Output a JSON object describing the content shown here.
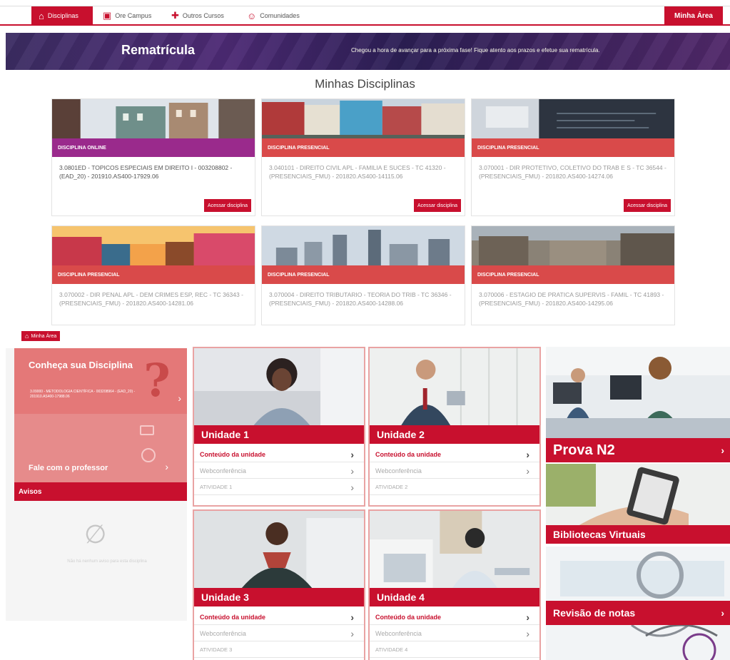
{
  "nav": {
    "disciplinas": "Disciplinas",
    "online_campus": "Ore Campus",
    "outros_cursos": "Outros Cursos",
    "comunidades": "Comunidades",
    "minha_area": "Minha Área"
  },
  "banner": {
    "title": "Rematrícula",
    "message": "Chegou a hora de avançar para a próxima fase! Fique atento aos prazos e efetue sua rematrícula."
  },
  "section_title": "Minhas Disciplinas",
  "courses": [
    {
      "type": "DISCIPLINA ONLINE",
      "name": "3.0801ED - TOPICOS ESPECIAIS EM DIREITO I - 003208802 - (EAD_20) - 201910.AS400-17929.06",
      "button": "Acessar disciplina"
    },
    {
      "type": "DISCIPLINA PRESENCIAL",
      "name": "3.040101 - DIREITO CIVIL APL - FAMILIA E SUCES - TC 41320 - (PRESENCIAIS_FMU) - 201820.AS400-14115.06",
      "button": "Acessar disciplina"
    },
    {
      "type": "DISCIPLINA PRESENCIAL",
      "name": "3.070001 - DIR PROTETIVO, COLETIVO DO TRAB E S - TC 36544 - (PRESENCIAIS_FMU) - 201820.AS400-14274.06",
      "button": "Acessar disciplina"
    },
    {
      "type": "DISCIPLINA PRESENCIAL",
      "name": "3.070002 - DIR PENAL APL - DEM CRIMES ESP, REC - TC 36343 - (PRESENCIAIS_FMU) - 201820.AS400-14281.06"
    },
    {
      "type": "DISCIPLINA PRESENCIAL",
      "name": "3.070004 - DIREITO TRIBUTARIO - TEORIA DO TRIB - TC 36346 - (PRESENCIAIS_FMU) - 201820.AS400-14288.06"
    },
    {
      "type": "DISCIPLINA PRESENCIAL",
      "name": "3.070006 - ESTAGIO DE PRATICA SUPERVIS - FAMIL - TC 41893 - (PRESENCIAIS_FMU) - 201820.AS400-14295.06"
    }
  ],
  "minha_area_tag": "Minha Área",
  "conheca": {
    "title": "Conheça sua Disciplina",
    "subtitle": "3.09000 - METODOLOGIA CIENTÍFICA - 003208964 - (EAD_20) - 201910.AS400-17988.06"
  },
  "fale": {
    "title": "Fale com o professor"
  },
  "avisos": {
    "title": "Avisos",
    "empty_text": "Não há nenhum aviso para esta disciplina"
  },
  "units": [
    {
      "title": "Unidade 1",
      "conteudo": "Conteúdo da unidade",
      "webconf": "Webconferência",
      "atividade": "ATIVIDADE 1"
    },
    {
      "title": "Unidade 2",
      "conteudo": "Conteúdo da unidade",
      "webconf": "Webconferência",
      "atividade": "ATIVIDADE 2"
    },
    {
      "title": "Unidade 3",
      "conteudo": "Conteúdo da unidade",
      "webconf": "Webconferência",
      "atividade": "ATIVIDADE 3"
    },
    {
      "title": "Unidade 4",
      "conteudo": "Conteúdo da unidade",
      "webconf": "Webconferência",
      "atividade": "ATIVIDADE 4"
    }
  ],
  "side": {
    "prova": "Prova N2",
    "bibliotecas": "Bibliotecas Virtuais",
    "revisao": "Revisão de notas"
  },
  "colors": {
    "brand_red": "#c8102e",
    "online_purple": "#9a2a8c",
    "presencial_red": "#d94a4a"
  }
}
